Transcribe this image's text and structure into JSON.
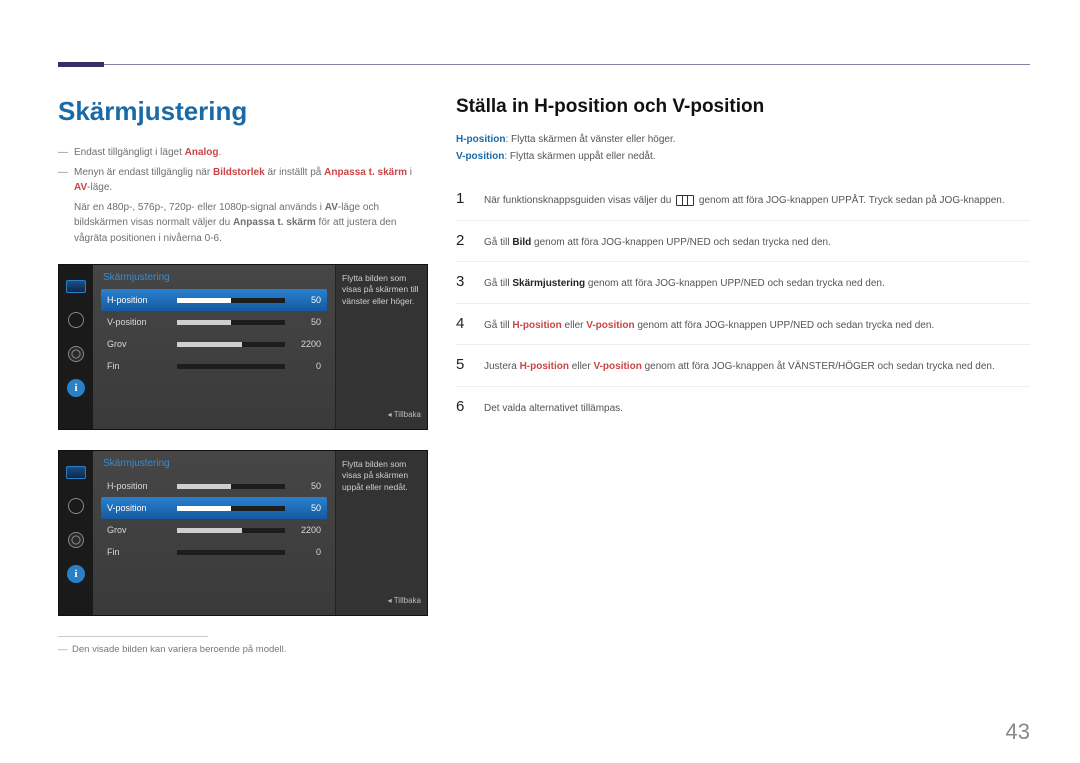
{
  "page_number": "43",
  "left": {
    "heading": "Skärmjustering",
    "notes": [
      {
        "segments": [
          {
            "t": "Endast tillgängligt i läget "
          },
          {
            "t": "Analog",
            "cls": "red"
          },
          {
            "t": "."
          }
        ]
      },
      {
        "segments": [
          {
            "t": "Menyn är endast tillgänglig när "
          },
          {
            "t": "Bildstorlek",
            "cls": "red"
          },
          {
            "t": " är inställt på "
          },
          {
            "t": "Anpassa t. skärm",
            "cls": "red"
          },
          {
            "t": " i "
          },
          {
            "t": "AV",
            "cls": "red"
          },
          {
            "t": "-läge."
          }
        ]
      }
    ],
    "note_sub": {
      "segments": [
        {
          "t": "När en 480p-, 576p-, 720p- eller 1080p-signal används i "
        },
        {
          "t": "AV",
          "cls": "red"
        },
        {
          "t": "-läge och bildskärmen visas normalt väljer du "
        },
        {
          "t": "Anpassa t. skärm",
          "cls": "red"
        },
        {
          "t": " för att justera den vågräta positionen i nivåerna 0-6."
        }
      ]
    },
    "footnote": "Den visade bilden kan variera beroende på modell."
  },
  "osd": [
    {
      "title": "Skärmjustering",
      "help": "Flytta bilden som visas på skärmen till vänster eller höger.",
      "back": "Tillbaka",
      "rows": [
        {
          "label": "H-position",
          "value": "50",
          "fill": 50,
          "selected": true
        },
        {
          "label": "V-position",
          "value": "50",
          "fill": 50,
          "selected": false
        },
        {
          "label": "Grov",
          "value": "2200",
          "fill": 60,
          "selected": false
        },
        {
          "label": "Fin",
          "value": "0",
          "fill": 0,
          "selected": false
        }
      ]
    },
    {
      "title": "Skärmjustering",
      "help": "Flytta bilden som visas på skärmen uppåt eller nedåt.",
      "back": "Tillbaka",
      "rows": [
        {
          "label": "H-position",
          "value": "50",
          "fill": 50,
          "selected": false
        },
        {
          "label": "V-position",
          "value": "50",
          "fill": 50,
          "selected": true
        },
        {
          "label": "Grov",
          "value": "2200",
          "fill": 60,
          "selected": false
        },
        {
          "label": "Fin",
          "value": "0",
          "fill": 0,
          "selected": false
        }
      ]
    }
  ],
  "right": {
    "heading": "Ställa in H-position och V-position",
    "defs": [
      {
        "segments": [
          {
            "t": "H-position",
            "cls": "blue"
          },
          {
            "t": ": Flytta skärmen åt vänster eller höger."
          }
        ]
      },
      {
        "segments": [
          {
            "t": "V-position",
            "cls": "blue"
          },
          {
            "t": ": Flytta skärmen uppåt eller nedåt."
          }
        ]
      }
    ],
    "steps": [
      {
        "num": "1",
        "segments": [
          {
            "t": "När funktionsknappsguiden visas väljer du "
          },
          {
            "icon": true
          },
          {
            "t": " genom att föra JOG-knappen UPPÅT. Tryck sedan på JOG-knappen."
          }
        ]
      },
      {
        "num": "2",
        "segments": [
          {
            "t": "Gå till "
          },
          {
            "t": "Bild",
            "cls": "dark"
          },
          {
            "t": " genom att föra JOG-knappen UPP/NED och sedan trycka ned den."
          }
        ]
      },
      {
        "num": "3",
        "segments": [
          {
            "t": "Gå till "
          },
          {
            "t": "Skärmjustering",
            "cls": "dark"
          },
          {
            "t": " genom att föra JOG-knappen UPP/NED och sedan trycka ned den."
          }
        ]
      },
      {
        "num": "4",
        "segments": [
          {
            "t": "Gå till "
          },
          {
            "t": "H-position",
            "cls": "red"
          },
          {
            "t": " eller "
          },
          {
            "t": "V-position",
            "cls": "red"
          },
          {
            "t": " genom att föra JOG-knappen UPP/NED och sedan trycka ned den."
          }
        ]
      },
      {
        "num": "5",
        "segments": [
          {
            "t": "Justera "
          },
          {
            "t": "H-position",
            "cls": "red"
          },
          {
            "t": " eller "
          },
          {
            "t": "V-position",
            "cls": "red"
          },
          {
            "t": " genom att föra JOG-knappen åt VÄNSTER/HÖGER och sedan trycka ned den."
          }
        ]
      },
      {
        "num": "6",
        "segments": [
          {
            "t": "Det valda alternativet tillämpas."
          }
        ]
      }
    ]
  }
}
